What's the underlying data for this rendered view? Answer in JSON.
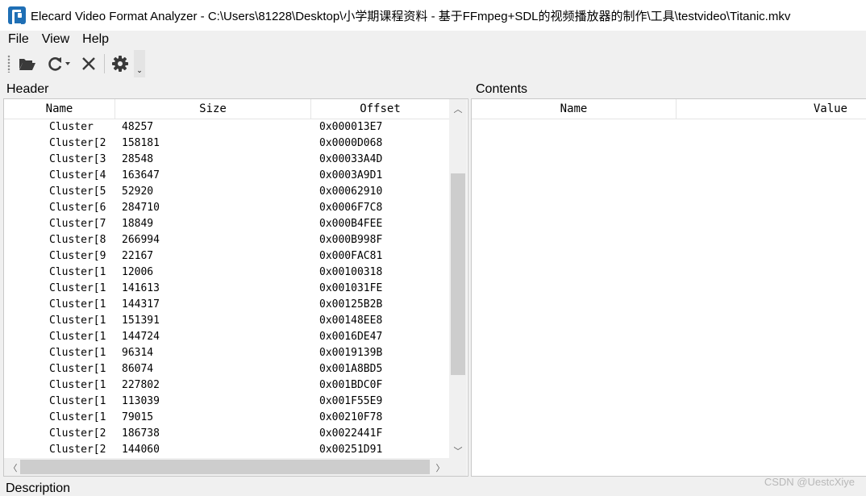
{
  "window": {
    "title": "Elecard Video Format Analyzer - C:\\Users\\81228\\Desktop\\小学期课程资料 - 基于FFmpeg+SDL的视频播放器的制作\\工具\\testvideo\\Titanic.mkv"
  },
  "menu": {
    "file": "File",
    "view": "View",
    "help": "Help"
  },
  "toolbar": {
    "open_icon": "folder-open-icon",
    "reload_icon": "refresh-icon",
    "close_icon": "close-icon",
    "settings_icon": "gear-icon",
    "overflow_glyph": "⌄"
  },
  "header_panel": {
    "caption": "Header",
    "columns": {
      "name": "Name",
      "size": "Size",
      "offset": "Offset"
    },
    "rows": [
      {
        "name": "Cluster",
        "size": "48257",
        "offset": "0x000013E7"
      },
      {
        "name": "Cluster[2",
        "size": "158181",
        "offset": "0x0000D068"
      },
      {
        "name": "Cluster[3",
        "size": "28548",
        "offset": "0x00033A4D"
      },
      {
        "name": "Cluster[4",
        "size": "163647",
        "offset": "0x0003A9D1"
      },
      {
        "name": "Cluster[5",
        "size": "52920",
        "offset": "0x00062910"
      },
      {
        "name": "Cluster[6",
        "size": "284710",
        "offset": "0x0006F7C8"
      },
      {
        "name": "Cluster[7",
        "size": "18849",
        "offset": "0x000B4FEE"
      },
      {
        "name": "Cluster[8",
        "size": "266994",
        "offset": "0x000B998F"
      },
      {
        "name": "Cluster[9",
        "size": "22167",
        "offset": "0x000FAC81"
      },
      {
        "name": "Cluster[1",
        "size": "12006",
        "offset": "0x00100318"
      },
      {
        "name": "Cluster[1",
        "size": "141613",
        "offset": "0x001031FE"
      },
      {
        "name": "Cluster[1",
        "size": "144317",
        "offset": "0x00125B2B"
      },
      {
        "name": "Cluster[1",
        "size": "151391",
        "offset": "0x00148EE8"
      },
      {
        "name": "Cluster[1",
        "size": "144724",
        "offset": "0x0016DE47"
      },
      {
        "name": "Cluster[1",
        "size": "96314",
        "offset": "0x0019139B"
      },
      {
        "name": "Cluster[1",
        "size": "86074",
        "offset": "0x001A8BD5"
      },
      {
        "name": "Cluster[1",
        "size": "227802",
        "offset": "0x001BDC0F"
      },
      {
        "name": "Cluster[1",
        "size": "113039",
        "offset": "0x001F55E9"
      },
      {
        "name": "Cluster[1",
        "size": "79015",
        "offset": "0x00210F78"
      },
      {
        "name": "Cluster[2",
        "size": "186738",
        "offset": "0x0022441F"
      },
      {
        "name": "Cluster[2",
        "size": "144060",
        "offset": "0x00251D91"
      }
    ]
  },
  "contents_panel": {
    "caption": "Contents",
    "columns": {
      "name": "Name",
      "value": "Value"
    }
  },
  "description_panel": {
    "caption": "Description"
  },
  "watermark": "CSDN @UestcXiye"
}
